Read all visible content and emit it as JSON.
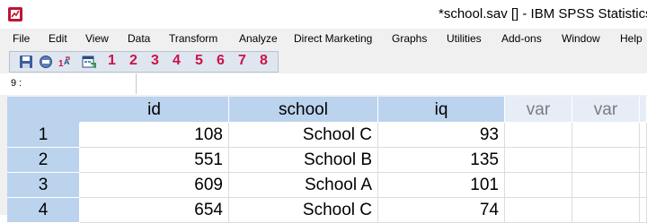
{
  "window": {
    "title": "*school.sav [] - IBM SPSS Statistics D"
  },
  "menu": [
    "File",
    "Edit",
    "View",
    "Data",
    "Transform",
    "Analyze",
    "Direct Marketing",
    "Graphs",
    "Utilities",
    "Add-ons",
    "Window",
    "Help"
  ],
  "toolbar": {
    "icons": [
      "save-icon",
      "recall-dialog-icon",
      "value-labels-icon",
      "run-script-icon"
    ],
    "numbers": [
      "1",
      "2",
      "3",
      "4",
      "5",
      "6",
      "7",
      "8"
    ],
    "accent": "#cc1149"
  },
  "cell_ref": "9 :",
  "columns": [
    "id",
    "school",
    "iq",
    "var",
    "var"
  ],
  "rows": [
    {
      "n": "1",
      "id": "108",
      "school": "School C",
      "iq": "93"
    },
    {
      "n": "2",
      "id": "551",
      "school": "School B",
      "iq": "135"
    },
    {
      "n": "3",
      "id": "609",
      "school": "School A",
      "iq": "101"
    },
    {
      "n": "4",
      "id": "654",
      "school": "School C",
      "iq": "74"
    }
  ]
}
